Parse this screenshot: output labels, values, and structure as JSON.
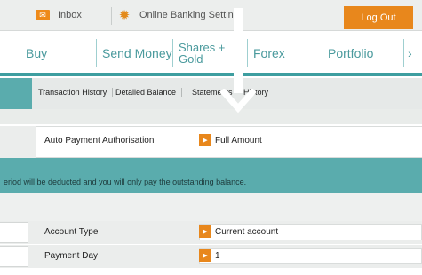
{
  "topbar": {
    "inbox_label": "Inbox",
    "settings_label": "Online Banking Settings",
    "logout_label": "Log Out",
    "inbox_icon": "envelope-icon",
    "settings_icon": "gear-icon"
  },
  "nav": {
    "items": [
      {
        "label": "Buy"
      },
      {
        "label": "Send Money"
      },
      {
        "label_line1": "Shares +",
        "label_line2": "Gold"
      },
      {
        "label": "Forex"
      },
      {
        "label": "Portfolio"
      }
    ],
    "more_arrow": "›"
  },
  "subnav": {
    "items": [
      "Transaction History",
      "Detailed Balance",
      "Statements",
      "History"
    ]
  },
  "auto_payment": {
    "label": "Auto Payment Authorisation",
    "value": "Full Amount"
  },
  "info_text": "eriod will be deducted and you will only pay the outstanding balance.",
  "rows": [
    {
      "label": "Account Type",
      "value": "Current account"
    },
    {
      "label": "Payment Day",
      "value": "1"
    }
  ],
  "colors": {
    "accent_orange": "#e8871c",
    "teal": "#5aacad",
    "nav_text": "#4a9a9d"
  }
}
